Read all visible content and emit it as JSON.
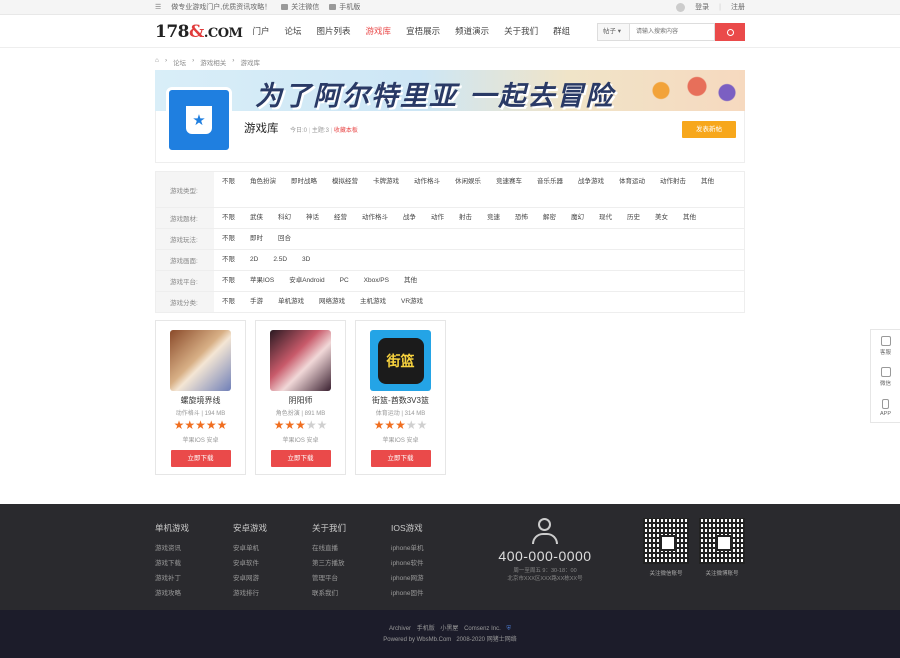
{
  "topbar": {
    "slogan": "做专业游戏门户,优质资讯攻略！",
    "wechat": "关注微信",
    "mobile": "手机版",
    "login": "登录",
    "register": "注册"
  },
  "header": {
    "logo_a": "178",
    "logo_b": "&",
    "logo_c": ".COM",
    "nav": [
      "门户",
      "论坛",
      "图片列表",
      "游戏库",
      "宣梧展示",
      "频道演示",
      "关于我们",
      "群组"
    ],
    "active_index": 3,
    "search_type": "帖子",
    "search_placeholder": "请输入搜索内容"
  },
  "breadcrumb": [
    "论坛",
    "游戏相关",
    "游戏库"
  ],
  "banner": {
    "text": "为了阿尔特里亚 一起去冒险"
  },
  "forum": {
    "title": "游戏库",
    "today_label": "今日:",
    "today_value": "0",
    "topic_label": "主题:",
    "topic_value": "3",
    "fav": "收藏本板",
    "post_button": "发表新帖"
  },
  "filters": [
    {
      "label": "游戏类型:",
      "options": [
        "不限",
        "角色扮演",
        "即时战略",
        "模拟经营",
        "卡牌游戏",
        "动作格斗",
        "休闲娱乐",
        "竞速赛车",
        "音乐乐器",
        "战争游戏",
        "体育运动",
        "动作射击",
        "其他"
      ]
    },
    {
      "label": "游戏题材:",
      "options": [
        "不限",
        "武侠",
        "科幻",
        "神话",
        "经营",
        "动作格斗",
        "战争",
        "动作",
        "射击",
        "竞速",
        "恐怖",
        "解密",
        "魔幻",
        "现代",
        "历史",
        "美女",
        "其他"
      ]
    },
    {
      "label": "游戏玩法:",
      "options": [
        "不限",
        "即时",
        "回合"
      ]
    },
    {
      "label": "游戏画面:",
      "options": [
        "不限",
        "2D",
        "2.5D",
        "3D"
      ]
    },
    {
      "label": "游戏平台:",
      "options": [
        "不限",
        "苹果IOS",
        "安卓Android",
        "PC",
        "Xbox/PS",
        "其他"
      ]
    },
    {
      "label": "游戏分类:",
      "options": [
        "不限",
        "手游",
        "单机游戏",
        "网络游戏",
        "主机游戏",
        "VR游戏"
      ]
    }
  ],
  "games": [
    {
      "name": "螺旋境界线",
      "genre": "动作格斗",
      "size": "194 MB",
      "rating": 5,
      "platform": "苹果IOS 安卓",
      "download": "立即下载"
    },
    {
      "name": "阴阳师",
      "genre": "角色扮演",
      "size": "891 MB",
      "rating": 3,
      "platform": "苹果IOS 安卓",
      "download": "立即下载"
    },
    {
      "name": "街篮-酋数3V3篮",
      "genre": "体育运动",
      "size": "314 MB",
      "rating": 3,
      "platform": "苹果IOS 安卓",
      "download": "立即下载"
    }
  ],
  "side": [
    "客服",
    "微信",
    "APP"
  ],
  "footer": {
    "cols": [
      {
        "title": "单机游戏",
        "items": [
          "游戏资讯",
          "游戏下载",
          "游戏补丁",
          "游戏攻略"
        ]
      },
      {
        "title": "安卓游戏",
        "items": [
          "安卓单机",
          "安卓软件",
          "安卓网游",
          "游戏排行"
        ]
      },
      {
        "title": "关于我们",
        "items": [
          "在线直播",
          "第三方播放",
          "管理平台",
          "联系我们"
        ]
      },
      {
        "title": "IOS游戏",
        "items": [
          "iphone单机",
          "iphone软件",
          "iphone网游",
          "iphone固件"
        ]
      }
    ],
    "phone": "400-000-0000",
    "hours": "周一至周五 9：30-18：00",
    "address": "北京市XXX区XXX路XX栋XX号",
    "qr1": "关注微信账号",
    "qr2": "关注微博账号",
    "links": [
      "Archiver",
      "手机版",
      "小黑屋",
      "Comsenz Inc."
    ],
    "powered": "Powered by WbsMb.Com",
    "copyright": "2008-2020 网猪士网络"
  },
  "colors": {
    "accent": "#ea4a4a",
    "post_button": "#f7a71b",
    "forum_icon": "#1f7fe0",
    "footer": "#2a2a2e"
  }
}
